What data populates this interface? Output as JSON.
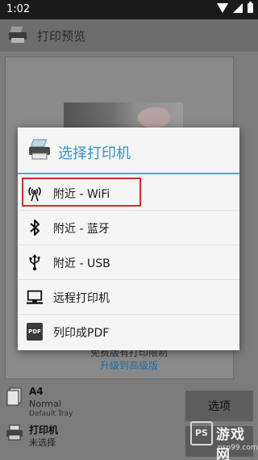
{
  "status_bar": {
    "time": "1:02"
  },
  "app_bar": {
    "title": "打印预览"
  },
  "preview": {
    "limit_text": "免费版有打印限制",
    "upgrade_link": "升级到高级版"
  },
  "bottom": {
    "paper_size": "A4",
    "paper_type": "Normal",
    "paper_tray": "Default Tray",
    "printer_label": "打印机",
    "printer_status": "未选择",
    "options_button": "选项"
  },
  "dialog": {
    "title": "选择打印机",
    "options": [
      {
        "label": "附近 - WiFi",
        "icon": "wifi-antenna-icon"
      },
      {
        "label": "附近 - 蓝牙",
        "icon": "bluetooth-icon"
      },
      {
        "label": "附近 - USB",
        "icon": "usb-icon"
      },
      {
        "label": "远程打印机",
        "icon": "computer-icon"
      },
      {
        "label": "列印成PDF",
        "icon": "pdf-icon"
      }
    ],
    "highlight_color": "#d82a2a",
    "accent_color": "#2a99c9"
  },
  "watermark": {
    "badge": "PS",
    "text": "游戏网",
    "url": "psp99.com"
  }
}
